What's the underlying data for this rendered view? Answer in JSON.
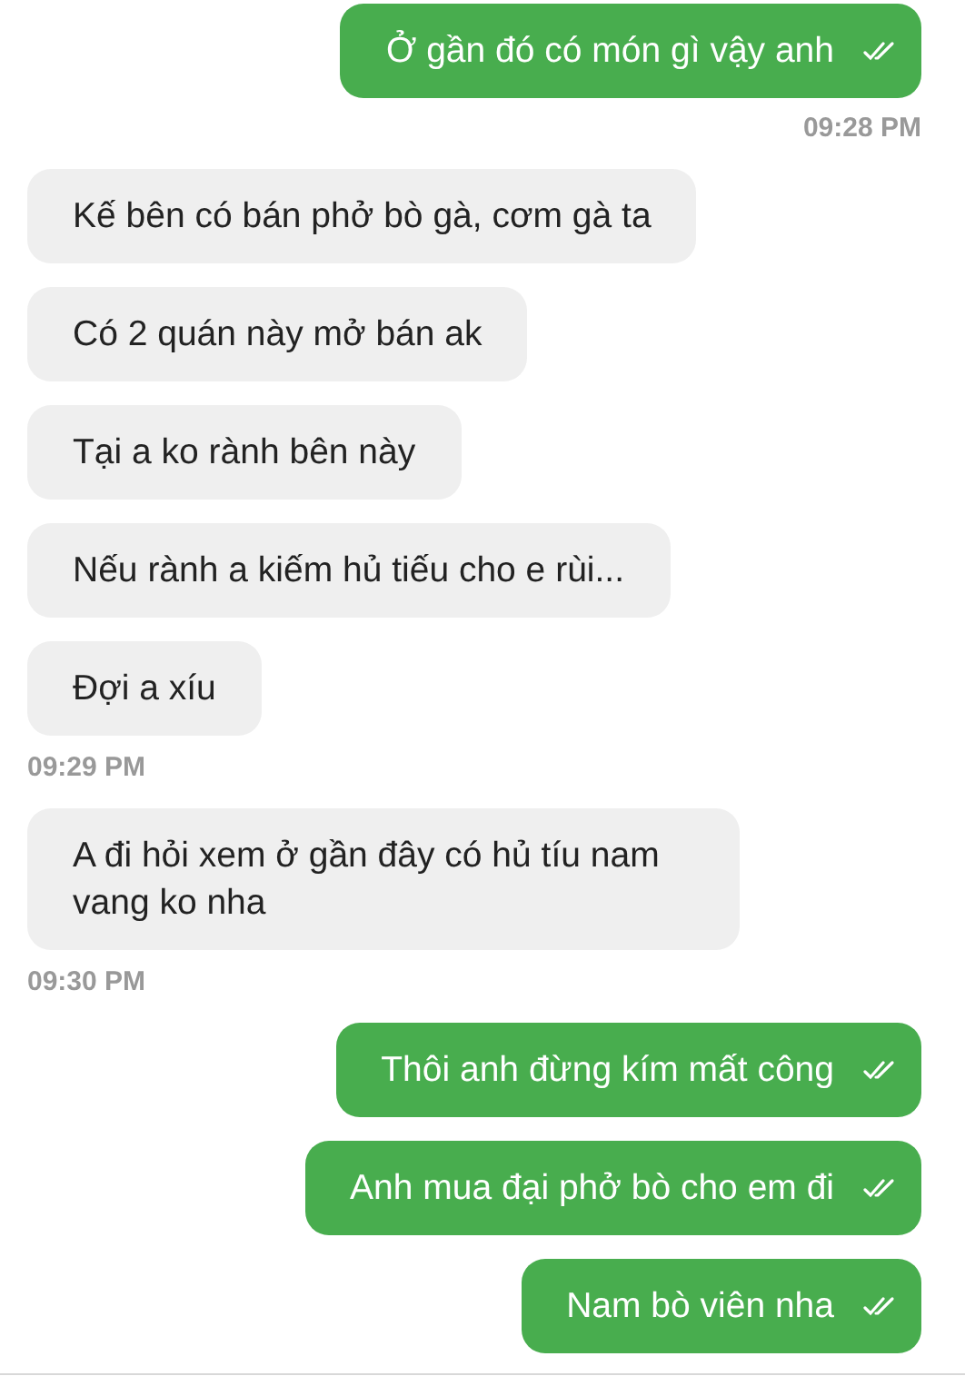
{
  "messages": [
    {
      "kind": "sent",
      "text": "Ở gần đó có món gì vậy anh"
    },
    {
      "kind": "time",
      "text": "09:28 PM"
    },
    {
      "kind": "received",
      "text": "Kế bên có bán phở bò gà, cơm gà ta"
    },
    {
      "kind": "received",
      "text": "Có 2 quán này mở bán ak"
    },
    {
      "kind": "received",
      "text": "Tại a ko rành bên này"
    },
    {
      "kind": "received",
      "text": "Nếu rành a kiếm hủ tiếu cho e rùi..."
    },
    {
      "kind": "received",
      "text": "Đợi a xíu"
    },
    {
      "kind": "time",
      "text": "09:29 PM"
    },
    {
      "kind": "received",
      "text": "A đi hỏi xem ở gần đây có hủ tíu nam vang ko nha"
    },
    {
      "kind": "time",
      "text": "09:30 PM"
    },
    {
      "kind": "sent",
      "text": "Thôi anh đừng kím mất công"
    },
    {
      "kind": "sent",
      "text": "Anh mua đại phở bò cho em đi"
    },
    {
      "kind": "sent",
      "text": "Nam bò viên nha"
    }
  ]
}
